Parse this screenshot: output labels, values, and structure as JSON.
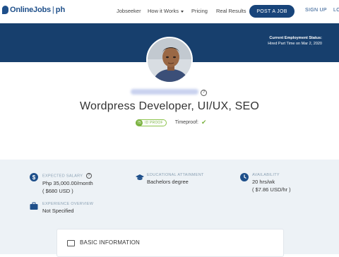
{
  "nav": {
    "logo_main": "OnlineJobs",
    "logo_sep": "|",
    "logo_suffix": "ph",
    "jobseeker": "Jobseeker",
    "how_it_works": "How it Works",
    "pricing": "Pricing",
    "real_results": "Real Results",
    "post_job": "POST A JOB",
    "signup": "SIGN UP",
    "login": "LO"
  },
  "banner": {
    "status_title": "Current Employment Status:",
    "status_value": "Hired Part Time on Mar 2, 2020"
  },
  "profile": {
    "headline": "Wordpress Developer, UI/UX, SEO",
    "id_proof_score": "75",
    "id_proof_label": "ID PROOF",
    "timeproof_label": "Timeproof:"
  },
  "info": {
    "salary_label": "EXPECTED SALARY",
    "salary_value": "Php 35,000.00/month",
    "salary_usd": "( $680 USD )",
    "education_label": "EDUCATIONAL ATTAINMENT",
    "education_value": "Bachelors degree",
    "availability_label": "AVAILABILITY",
    "availability_value": "20 hrs/wk",
    "availability_usd": "( $7.86 USD/hr )",
    "experience_label": "EXPERIENCE OVERVIEW",
    "experience_value": "Not Specified"
  },
  "basic": {
    "title": "BASIC INFORMATION"
  },
  "colors": {
    "brand": "#1e4f8a",
    "banner": "#173f6d",
    "accent_green": "#7cb342",
    "info_bg": "#edf2f6"
  }
}
